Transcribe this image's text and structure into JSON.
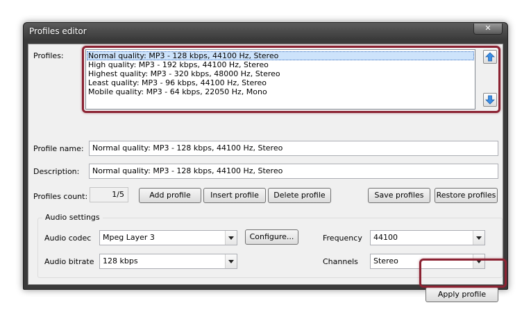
{
  "window": {
    "title": "Profiles editor",
    "close_glyph": "✕"
  },
  "profiles": {
    "label": "Profiles:",
    "items": [
      "Normal quality: MP3 - 128 kbps, 44100 Hz, Stereo",
      "High quality: MP3 - 192 kbps, 44100 Hz, Stereo",
      "Highest quality: MP3 - 320 kbps, 48000 Hz, Stereo",
      "Least quality: MP3 - 96 kbps, 44100 Hz, Stereo",
      "Mobile quality: MP3 - 64 kbps, 22050 Hz, Mono"
    ],
    "selected_index": 0
  },
  "profile_name": {
    "label": "Profile name:",
    "value": "Normal quality: MP3 - 128 kbps, 44100 Hz, Stereo"
  },
  "description": {
    "label": "Description:",
    "value": "Normal quality: MP3 - 128 kbps, 44100 Hz, Stereo"
  },
  "profiles_count": {
    "label": "Profiles count:",
    "value": "1/5"
  },
  "buttons": {
    "add": "Add profile",
    "insert": "Insert profile",
    "delete": "Delete profile",
    "save": "Save profiles",
    "restore": "Restore profiles",
    "configure": "Configure...",
    "apply": "Apply profile"
  },
  "audio_settings": {
    "title": "Audio settings",
    "codec": {
      "label": "Audio codec",
      "value": "Mpeg Layer 3"
    },
    "bitrate": {
      "label": "Audio bitrate",
      "value": "128 kbps"
    },
    "frequency": {
      "label": "Frequency",
      "value": "44100"
    },
    "channels": {
      "label": "Channels",
      "value": "Stereo"
    }
  },
  "icons": {
    "move_up": "arrow-up-icon",
    "move_down": "arrow-down-icon",
    "dropdown": "chevron-down-icon",
    "close": "close-icon"
  },
  "colors": {
    "highlight": "#8b2232",
    "arrow_blue": "#3a8ee6",
    "selection": "#cde3fb"
  }
}
